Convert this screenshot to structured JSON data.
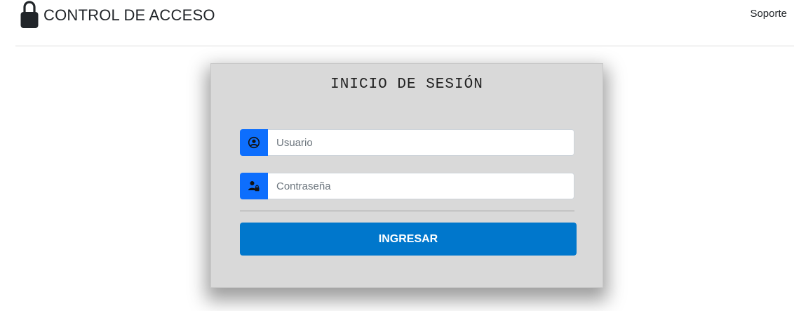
{
  "header": {
    "brand_icon": "lock-icon",
    "brand_title": "CONTROL DE ACCESO",
    "support_link": "Soporte"
  },
  "login": {
    "title": "INICIO DE SESIÓN",
    "username": {
      "icon": "user-circle-icon",
      "value": "",
      "placeholder": "Usuario"
    },
    "password": {
      "icon": "user-lock-icon",
      "value": "",
      "placeholder": "Contraseña"
    },
    "submit_label": "INGRESAR"
  },
  "colors": {
    "accent": "#0d6efd",
    "button": "#0077cc",
    "card_background": "#d9d9d9"
  }
}
